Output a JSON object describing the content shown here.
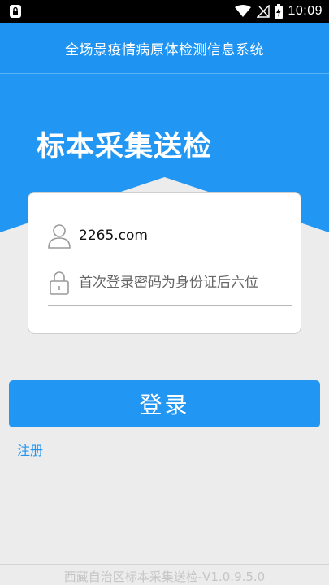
{
  "status_bar": {
    "time": "10:09",
    "icons": [
      "lock-icon",
      "wifi-icon",
      "signal-off-icon",
      "battery-charging-icon"
    ]
  },
  "app_bar": {
    "title": "全场景疫情病原体检测信息系统"
  },
  "hero": {
    "title": "标本采集送检"
  },
  "login_form": {
    "username": {
      "value": "2265.com",
      "icon": "user-icon"
    },
    "password": {
      "placeholder": "首次登录密码为身份证后六位",
      "icon": "padlock-icon"
    },
    "login_label": "登录"
  },
  "register_label": "注册",
  "footer": {
    "version_text": "西藏自治区标本采集送检-V1.0.9.5.0"
  },
  "colors": {
    "primary": "#2196f3",
    "background": "#ececec",
    "status_bar": "#000000"
  }
}
